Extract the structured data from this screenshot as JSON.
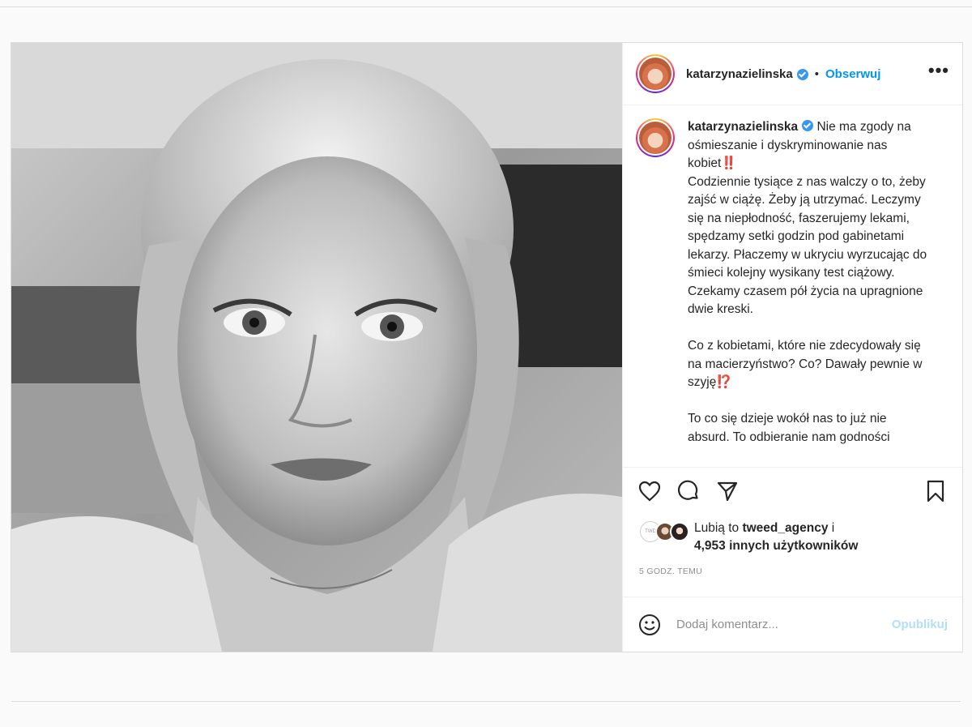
{
  "post": {
    "author": "katarzynazielinska",
    "separator": "•",
    "follow_label": "Obserwuj",
    "more_label": "•••",
    "caption": "Nie ma zgody na ośmieszanie i dyskryminowanie nas kobiet‼️\nCodziennie tysiące z nas walczy o to, żeby zajść w ciążę. Żeby ją utrzymać. Leczymy się na niepłodność, faszerujemy lekami, spędzamy setki godzin pod gabinetami lekarzy. Płaczemy w ukryciu wyrzucając do śmieci kolejny wysikany test ciążowy. Czekamy czasem pół życia na upragnione dwie kreski.\n\nCo z kobietami, które nie zdecydowały się na macierzyństwo? Co? Dawały pewnie w szyję⁉️\n\nTo co się dzieje wokół nas to już nie absurd. To odbieranie nam godności",
    "likes_prefix": "Lubią to ",
    "likes_user": "tweed_agency",
    "likes_mid": " i",
    "likes_count": "4,953 innych użytkowników",
    "liker_badge": "TWD",
    "timestamp": "5 GODZ. TEMU",
    "comment_placeholder": "Dodaj komentarz...",
    "publish_label": "Opublikuj"
  },
  "icons": {
    "like": "heart-icon",
    "comment": "comment-icon",
    "share": "share-icon",
    "save": "bookmark-icon",
    "emoji": "emoji-icon",
    "verified": "verified-icon"
  },
  "colors": {
    "accent": "#0095f6",
    "publish_disabled": "#b2dffc",
    "verified": "#3897f0",
    "muted": "#8e8e8e"
  }
}
